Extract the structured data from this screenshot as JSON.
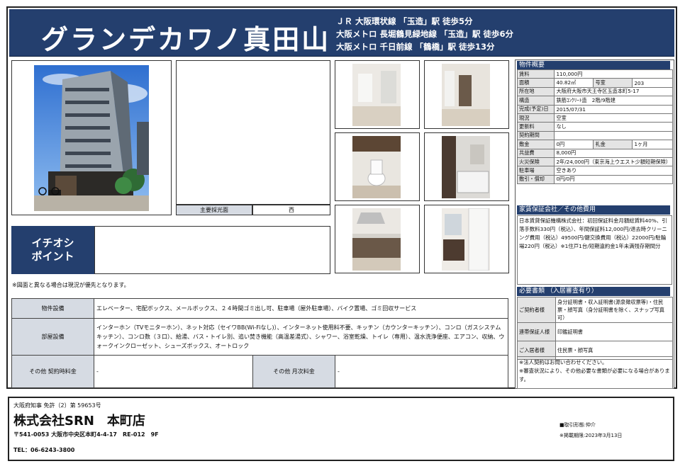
{
  "header": {
    "property_name": "グランデカワノ真田山",
    "stations": [
      "ＪＲ 大阪環状線 「玉造」駅 徒歩5分",
      "大阪メトロ 長堀鶴見緑地線 「玉造」駅 徒歩6分",
      "大阪メトロ 千日前線 「鶴橋」駅 徒歩13分"
    ]
  },
  "photos": {
    "light_label": "主要採光面",
    "light_value": "西"
  },
  "pickup": {
    "label_line1": "イチオシ",
    "label_line2": "ポイント",
    "text": ""
  },
  "notice": "※図面と異なる場合は現況が優先となります。",
  "facilities": {
    "building_label": "物件設備",
    "building_value": "エレベーター、宅配ボックス、メールボックス、２４時間ゴミ出し可、駐車場（屋外駐車場）、バイク置場、ゴミ回収サービス",
    "room_label": "部屋設備",
    "room_value": "インターホン（TVモニターホン）、ネット対応（セイワBB(Wi-Fiなし)）、インターネット使用料不要、キッチン（カウンターキッチン）、コンロ（ガスシステムキッチン）、コンロ数（３口）、給湯、バス・トイレ別、追い焚き機能（高温差湯式）、シャワー、浴室乾燥、トイレ（専用）、温水洗浄便座、エアコン、収納、ウォークインクローゼット、シューズボックス、オートロック",
    "contract_fee_label": "その他 契約時料金",
    "contract_fee_value": "-",
    "monthly_fee_label": "その他 月次料金",
    "monthly_fee_value": "-"
  },
  "summary": {
    "heading": "物件概要",
    "rent_label": "賃料",
    "rent_value": "110,000円",
    "area_label": "面積",
    "area_value": "40.82㎡",
    "room_no_label": "号室",
    "room_no_value": "203",
    "address_label": "所在地",
    "address_value": "大阪府大阪市天王寺区玉造本町5-17",
    "structure_label": "構造",
    "structure_value": "鉄筋ｺﾝｸﾘｰﾄ造　2階/9階建",
    "built_label": "完成(予定)日",
    "built_value": "2015/07/31",
    "status_label": "現況",
    "status_value": "空室",
    "renewal_label": "更新料",
    "renewal_value": "なし",
    "period_label": "契約期間",
    "period_value": "",
    "deposit_label": "敷金",
    "deposit_value": "0円",
    "key_money_label": "礼金",
    "key_money_value": "1ヶ月",
    "common_label": "共益費",
    "common_value": "8,000円",
    "insurance_label": "火災保険",
    "insurance_value": "2年/24,000円（東京海上ウエスト少額短期保険）",
    "parking_label": "駐車場",
    "parking_value": "空きあり",
    "deduction_label": "敷引・償却",
    "deduction_value": "0円/0円"
  },
  "guarantee": {
    "heading": "家賃保証会社／その他費用",
    "text": "日本賃貸保証機構株式会社：初回保証料金月額総賃料40%、引落手数料330円（税込）、年間保証料12,000円/退去時クリーニング費用（税込）49500円/鍵交換費用（税込）22000円/駐輪場220円（税込）※1住戸1台/短期違約金1年未満残存期間分"
  },
  "documents": {
    "heading": "必要書類 （入居審査有り）",
    "applicant_label": "ご契約者様",
    "applicant_value": "身分証明書・収入証明書(源泉徴収票等)・住民票・顔写真（身分証明書を除く、スナップ写真可）",
    "guarantor_label": "連帯保証人様",
    "guarantor_value": "印鑑証明書",
    "resident_label": "ご入居者様",
    "resident_value": "住民票・顔写真",
    "note1": "※法人契約はお問い合わせください。",
    "note2": "※審査状況により、その他必要な書類が必要になる場合があります。"
  },
  "footer": {
    "license": "大阪府知事 免許（2）第 59653号",
    "company": "株式会社SRN　本町店",
    "address": "〒541-0053 大阪市中央区本町4-4-17　RE-012　9F",
    "tel": "TEL：06-6243-3800",
    "transaction": "■取引形態:仲介",
    "published": "※掲載期限:2023年3月13日"
  },
  "colors": {
    "header_navy": "#243f6e",
    "label_gray": "#d6dbe3"
  }
}
